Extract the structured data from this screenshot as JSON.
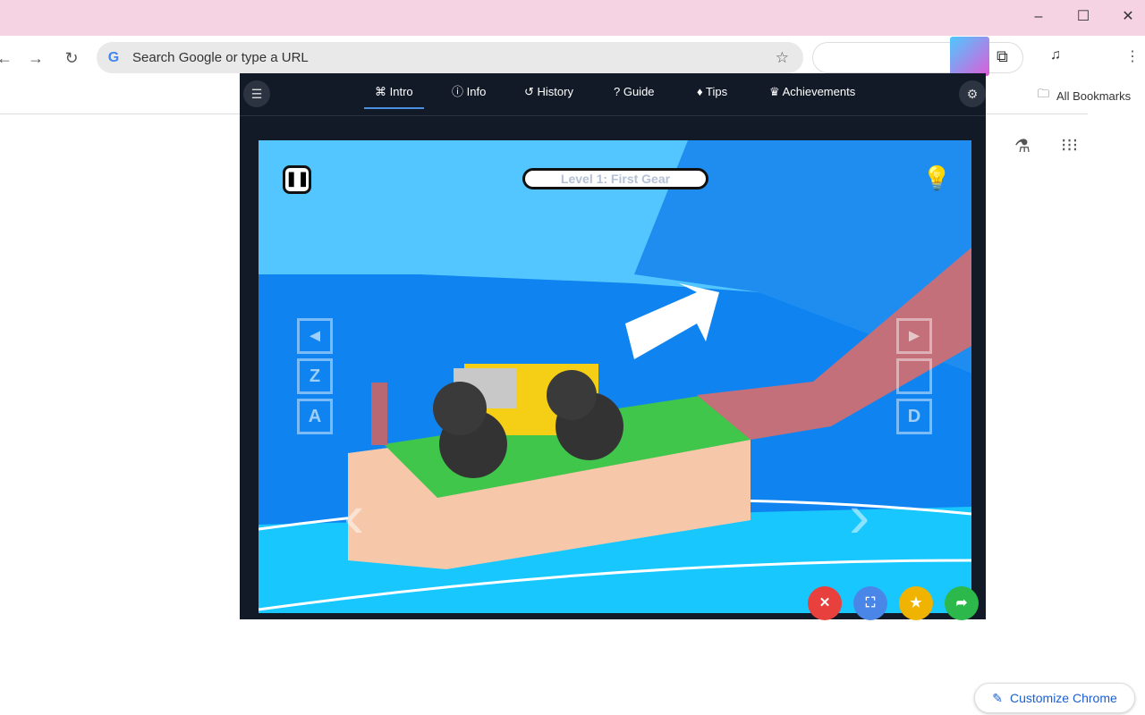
{
  "browser": {
    "omnibox_placeholder": "Search Google or type a URL",
    "all_bookmarks": "All Bookmarks",
    "customize": "Customize Chrome"
  },
  "popup": {
    "tabs": [
      {
        "label": "Intro",
        "icon": "gamepad-icon",
        "active": true
      },
      {
        "label": "Info",
        "icon": "info-icon"
      },
      {
        "label": "History",
        "icon": "history-icon"
      },
      {
        "label": "Guide",
        "icon": "question-icon"
      },
      {
        "label": "Tips",
        "icon": "lightbulb-icon"
      },
      {
        "label": "Achievements",
        "icon": "trophy-icon"
      }
    ]
  },
  "game": {
    "level_title": "Level 1: First Gear",
    "keys_left": [
      "◄",
      "Z",
      "A"
    ],
    "keys_right": [
      "►",
      "",
      "D"
    ]
  },
  "colors": {
    "close": "#e8413d",
    "fullscreen": "#4a86e8",
    "favorite": "#f0b400",
    "share": "#2db84b",
    "accent": "#4a8fe0"
  }
}
